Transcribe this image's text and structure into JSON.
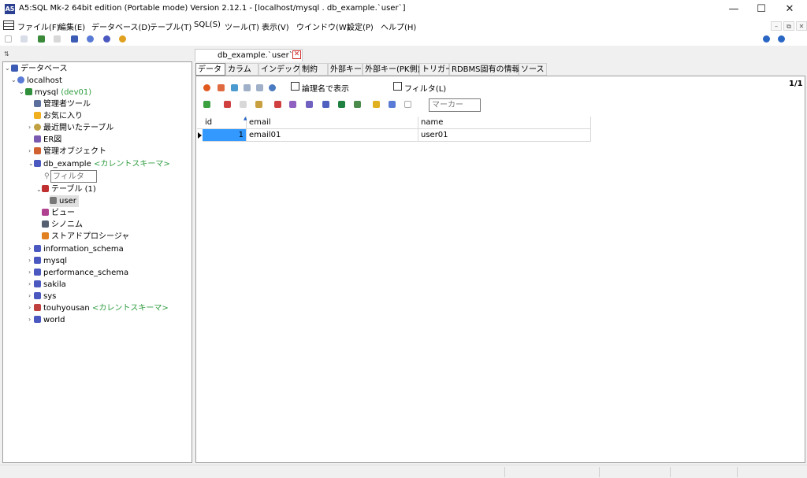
{
  "window": {
    "title": "A5:SQL Mk-2 64bit edition (Portable mode) Version 2.12.1 - [localhost/mysql . db_example.`user`]",
    "icon_text": "A5",
    "minimize": "—",
    "maximize": "☐",
    "close": "✕"
  },
  "menu": {
    "items": [
      "ファイル(F)",
      "編集(E)",
      "データベース(D)",
      "テーブル(T)",
      "SQL(S)",
      "ツール(T)",
      "表示(V)",
      "ウインドウ(W)",
      "設定(P)",
      "ヘルプ(H)"
    ],
    "mdi_min": "–",
    "mdi_restore": "⧉",
    "mdi_close": "✕"
  },
  "tree": {
    "root": "データベース",
    "localhost": "localhost",
    "mysql_conn": "mysql",
    "mysql_conn_note": "(dev01)",
    "admin_tools": "管理者ツール",
    "favorites": "お気に入り",
    "recent_tables": "最近開いたテーブル",
    "er": "ER図",
    "admin_objects": "管理オブジェクト",
    "db_example": "db_example",
    "current_schema": "<カレントスキーマ>",
    "filter_placeholder": "フィルタ",
    "tables": "テーブル",
    "tables_count": "(1)",
    "user_table": "user",
    "views": "ビュー",
    "synonyms": "シノニム",
    "procedures": "ストアドプロシージャ",
    "schemas": [
      "information_schema",
      "mysql",
      "performance_schema",
      "sakila",
      "sys",
      "touhyousan",
      "world"
    ],
    "touhyousan_note": "<カレントスキーマ>"
  },
  "document_tab": {
    "label": "db_example.`user`",
    "close": "✕"
  },
  "subtabs": [
    "データ",
    "カラム",
    "インデックス",
    "制約",
    "外部キー",
    "外部キー(PK側)",
    "トリガー",
    "RDBMS固有の情報",
    "ソース"
  ],
  "data_toolbar": {
    "show_logical_name": "論理名で表示",
    "filter": "フィルタ(L)",
    "page_indicator": "1/1",
    "marker_placeholder": "マーカー"
  },
  "grid": {
    "columns": [
      "id",
      "email",
      "name"
    ],
    "rows": [
      [
        "1",
        "email01",
        "user01"
      ]
    ]
  },
  "colors": {
    "accent_selected_cell": "#3399ff",
    "schema_note": "#2e9b3f"
  }
}
